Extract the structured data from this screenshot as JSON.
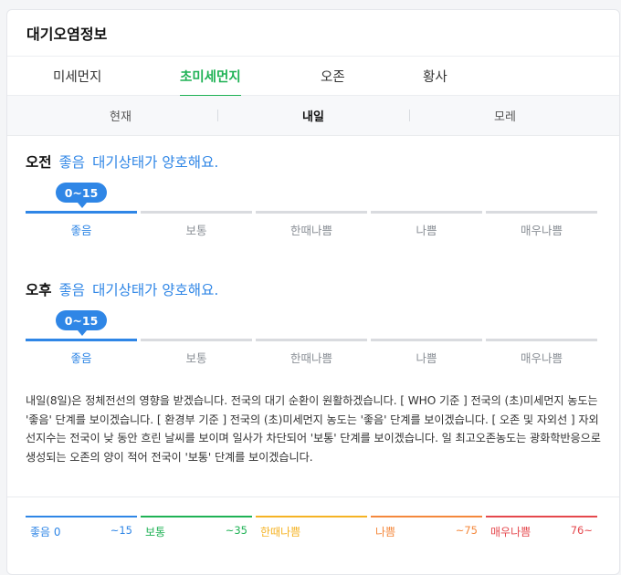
{
  "title": "대기오염정보",
  "tabs": [
    {
      "label": "미세먼지"
    },
    {
      "label": "초미세먼지"
    },
    {
      "label": "오존"
    },
    {
      "label": "황사"
    }
  ],
  "days": [
    {
      "label": "현재"
    },
    {
      "label": "내일"
    },
    {
      "label": "모레"
    }
  ],
  "morning": {
    "ampm": "오전",
    "grade": "좋음",
    "message": "대기상태가 양호해요.",
    "value_range": "0~15"
  },
  "afternoon": {
    "ampm": "오후",
    "grade": "좋음",
    "message": "대기상태가 양호해요.",
    "value_range": "0~15"
  },
  "scale_labels": [
    "좋음",
    "보통",
    "한때나쁨",
    "나쁨",
    "매우나쁨"
  ],
  "description": "내일(8일)은 정체전선의 영향을 받겠습니다. 전국의 대기 순환이 원활하겠습니다. [ WHO 기준 ] 전국의 (초)미세먼지 농도는 '좋음' 단계를 보이겠습니다. [ 환경부 기준 ] 전국의 (초)미세먼지 농도는 '좋음' 단계를 보이겠습니다. [ 오존 및 자외선 ] 자외선지수는 전국이 낮 동안 흐린 날씨를 보이며 일사가 차단되어 '보통' 단계를 보이겠습니다. 일 최고오존농도는 광화학반응으로 생성되는 오존의 양이 적어 전국이 '보통' 단계를 보이겠습니다.",
  "legend": [
    {
      "label": "좋음",
      "value": "0",
      "range": "~15",
      "color": "#2f86e6"
    },
    {
      "label": "보통",
      "value": "",
      "range": "~35",
      "color": "#1fb255"
    },
    {
      "label": "한때나쁨",
      "value": "",
      "range": "",
      "color": "#f5b324"
    },
    {
      "label": "나쁨",
      "value": "",
      "range": "~75",
      "color": "#f4883c"
    },
    {
      "label": "매우나쁨",
      "value": "",
      "range": "76~",
      "color": "#e5484d"
    }
  ],
  "colors": {
    "accent_green": "#1fb255",
    "accent_blue": "#2f86e6"
  }
}
